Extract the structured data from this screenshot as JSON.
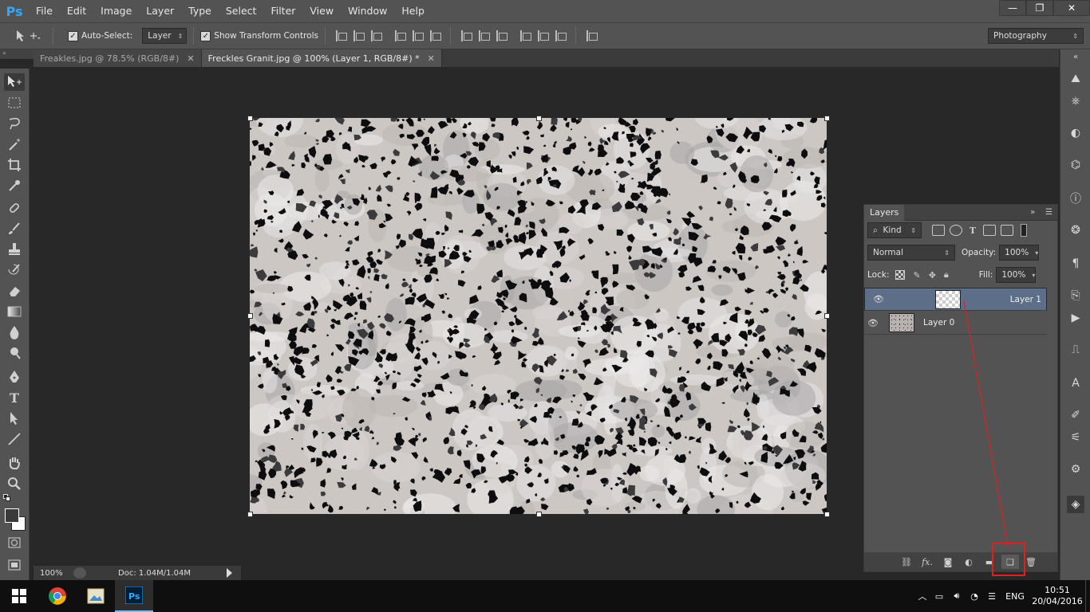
{
  "app": {
    "logo": "Ps"
  },
  "menu": [
    "File",
    "Edit",
    "Image",
    "Layer",
    "Type",
    "Select",
    "Filter",
    "View",
    "Window",
    "Help"
  ],
  "window_controls": {
    "minimize": "—",
    "restore": "❐",
    "close": "✕"
  },
  "options": {
    "auto_select_label": "Auto-Select:",
    "auto_select_checked": true,
    "auto_select_target": "Layer",
    "transform_controls_label": "Show Transform Controls",
    "transform_controls_checked": true,
    "workspace": "Photography"
  },
  "tabs": [
    {
      "label": "Freakles.jpg @ 78.5% (RGB/8#)",
      "active": false
    },
    {
      "label": "Freckles Granit.jpg @ 100% (Layer 1, RGB/8#) *",
      "active": true
    }
  ],
  "status": {
    "zoom": "100%",
    "doc": "Doc: 1.04M/1.04M"
  },
  "layers_panel": {
    "title": "Layers",
    "filter_kind": "Kind",
    "blend_mode": "Normal",
    "opacity_label": "Opacity:",
    "opacity": "100%",
    "lock_label": "Lock:",
    "fill_label": "Fill:",
    "fill": "100%",
    "layers": [
      {
        "name": "Layer 1",
        "selected": true,
        "thumb": "transparent"
      },
      {
        "name": "Layer 0",
        "selected": false,
        "thumb": "granite"
      }
    ],
    "bottom_buttons": [
      "link",
      "fx",
      "mask",
      "adjustment",
      "group",
      "new-layer",
      "delete"
    ]
  },
  "annotation": {
    "color": "#e02020"
  },
  "taskbar": {
    "lang": "ENG",
    "time": "10:51",
    "date": "20/04/2016"
  },
  "colors": {
    "accent": "#31a8ff",
    "selected_layer": "#5d6f88"
  }
}
